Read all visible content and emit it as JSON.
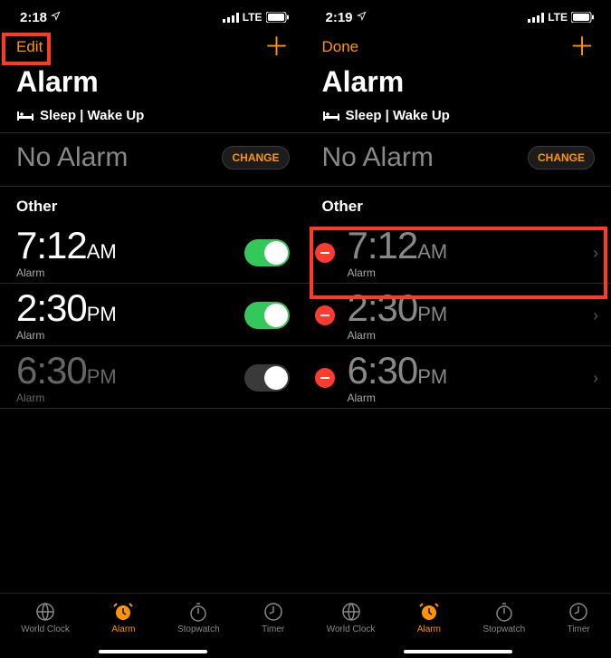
{
  "left": {
    "status_time": "2:18",
    "lte": "LTE",
    "nav_left": "Edit",
    "title": "Alarm",
    "sleep_label": "Sleep | Wake Up",
    "no_alarm": "No Alarm",
    "change": "CHANGE",
    "other_label": "Other",
    "alarms": [
      {
        "time": "7:12",
        "ampm": "AM",
        "sub": "Alarm",
        "on": true
      },
      {
        "time": "2:30",
        "ampm": "PM",
        "sub": "Alarm",
        "on": true
      },
      {
        "time": "6:30",
        "ampm": "PM",
        "sub": "Alarm",
        "on": false
      }
    ]
  },
  "right": {
    "status_time": "2:19",
    "lte": "LTE",
    "nav_left": "Done",
    "title": "Alarm",
    "sleep_label": "Sleep | Wake Up",
    "no_alarm": "No Alarm",
    "change": "CHANGE",
    "other_label": "Other",
    "alarms": [
      {
        "time": "7:12",
        "ampm": "AM",
        "sub": "Alarm"
      },
      {
        "time": "2:30",
        "ampm": "PM",
        "sub": "Alarm"
      },
      {
        "time": "6:30",
        "ampm": "PM",
        "sub": "Alarm"
      }
    ]
  },
  "tabs": {
    "world_clock": "World Clock",
    "alarm": "Alarm",
    "stopwatch": "Stopwatch",
    "timer": "Timer"
  }
}
